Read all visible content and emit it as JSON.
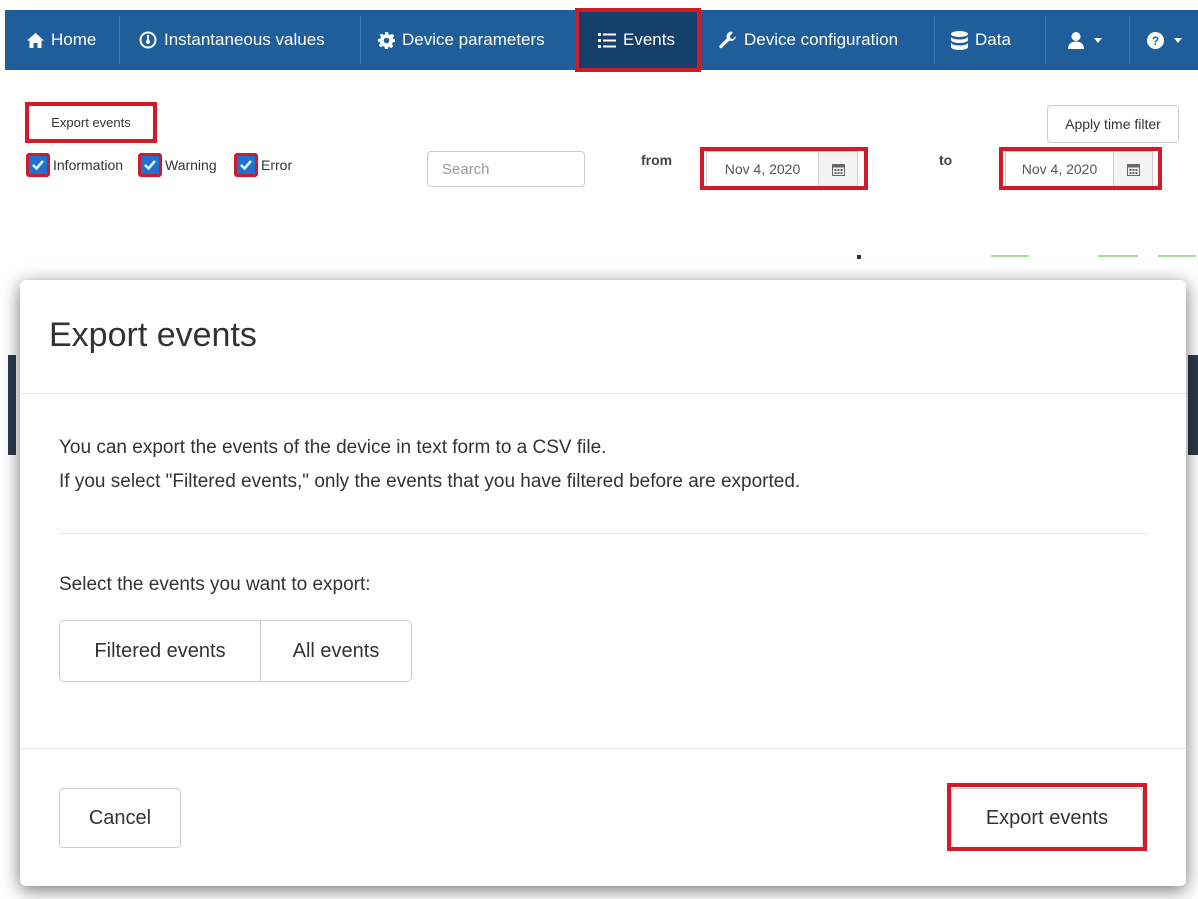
{
  "navbar": {
    "items": [
      {
        "label": "Home",
        "icon": "home-icon"
      },
      {
        "label": "Instantaneous values",
        "icon": "gauge-icon"
      },
      {
        "label": "Device parameters",
        "icon": "gear-icon"
      },
      {
        "label": "Events",
        "icon": "list-icon",
        "active": true
      },
      {
        "label": "Device configuration",
        "icon": "wrench-icon"
      },
      {
        "label": "Data",
        "icon": "database-icon"
      }
    ],
    "user_icon": "user-icon",
    "help_icon": "help-icon",
    "colors": {
      "bar": "#1f5d9b",
      "active": "#143f6b",
      "highlight": "#d01c2a"
    }
  },
  "toolbar": {
    "export_label": "Export events",
    "apply_label": "Apply time filter",
    "filters": [
      {
        "label": "Information",
        "checked": true
      },
      {
        "label": "Warning",
        "checked": true
      },
      {
        "label": "Error",
        "checked": true
      }
    ],
    "search_placeholder": "Search",
    "from_label": "from",
    "to_label": "to",
    "from_date": "Nov 4, 2020",
    "to_date": "Nov 4, 2020"
  },
  "modal": {
    "title": "Export events",
    "line1": "You can export the events of the device in text form to a CSV file.",
    "line2": "If you select \"Filtered events,\" only the events that you have filtered before are exported.",
    "select_prompt": "Select the events you want to export:",
    "options": [
      "Filtered events",
      "All events"
    ],
    "cancel_label": "Cancel",
    "export_label": "Export events"
  }
}
